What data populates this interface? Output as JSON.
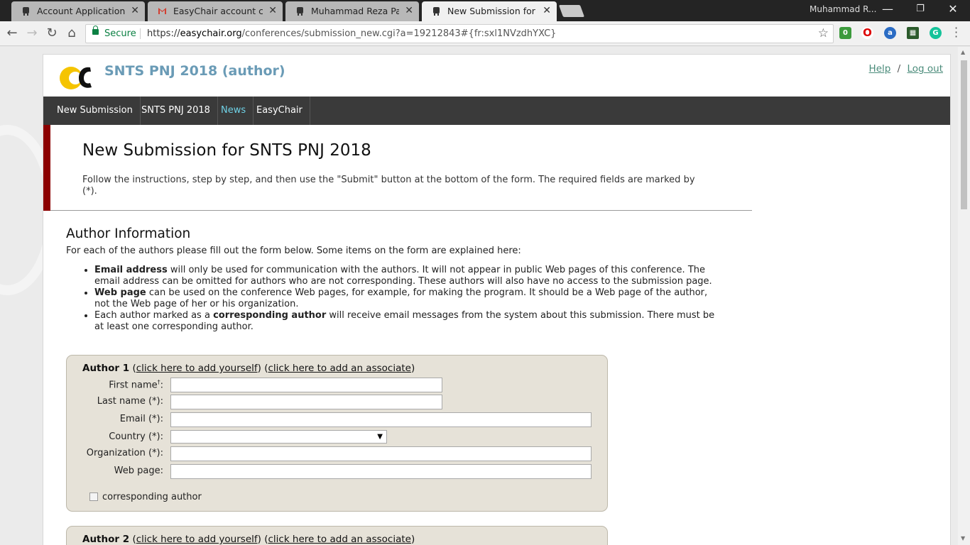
{
  "browser": {
    "tabs": [
      {
        "title": "Account Application Rece",
        "favicon": "easychair"
      },
      {
        "title": "EasyChair account confir",
        "favicon": "gmail"
      },
      {
        "title": "Muhammad Reza Pahlevi",
        "favicon": "easychair"
      },
      {
        "title": "New Submission for SNTS",
        "favicon": "easychair"
      }
    ],
    "profile_name": "Muhammad R...",
    "secure_label": "Secure",
    "url_scheme": "https://",
    "url_host": "easychair.org",
    "url_path": "/conferences/submission_new.cgi?a=19212843#{fr:sxl1NVzdhYXC}",
    "extension_badge": "0",
    "accent_colors": {
      "menubar": "#3a3a3a",
      "menu_accent": "#6fd1e6",
      "red_bar": "#8b0000",
      "title": "#6a9bb6"
    }
  },
  "header": {
    "conference_title": "SNTS PNJ 2018 (author)",
    "help_label": "Help",
    "separator": "/",
    "logout_label": "Log out"
  },
  "menu": [
    {
      "label": "New Submission"
    },
    {
      "label": "SNTS PNJ 2018"
    },
    {
      "label": "News"
    },
    {
      "label": "EasyChair"
    }
  ],
  "page": {
    "title": "New Submission for SNTS PNJ 2018",
    "instructions": "Follow the instructions, step by step, and then use the \"Submit\" button at the bottom of the form. The required fields are marked by (*)."
  },
  "author_info": {
    "title": "Author Information",
    "intro": "For each of the authors please fill out the form below. Some items on the form are explained here:",
    "bullets": [
      {
        "bold": "Email address",
        "text": " will only be used for communication with the authors. It will not appear in public Web pages of this conference. The email address can be omitted for authors who are not corresponding. These authors will also have no access to the submission page."
      },
      {
        "bold": "Web page",
        "text": " can be used on the conference Web pages, for example, for making the program. It should be a Web page of the author, not the Web page of her or his organization."
      },
      {
        "pre": "Each author marked as a ",
        "bold": "corresponding author",
        "text": " will receive email messages from the system about this submission. There must be at least one corresponding author."
      }
    ]
  },
  "author1": {
    "label": "Author 1",
    "add_yourself": "click here to add yourself",
    "add_associate": "click here to add an associate",
    "fields": {
      "first_name": "First name",
      "first_name_mark": "†",
      "last_name": "Last name (*):",
      "email": "Email (*):",
      "country": "Country (*):",
      "organization": "Organization (*):",
      "web_page": "Web page:"
    },
    "corresponding_label": "corresponding author"
  },
  "author2": {
    "label": "Author 2",
    "add_yourself": "click here to add yourself",
    "add_associate": "click here to add an associate"
  }
}
